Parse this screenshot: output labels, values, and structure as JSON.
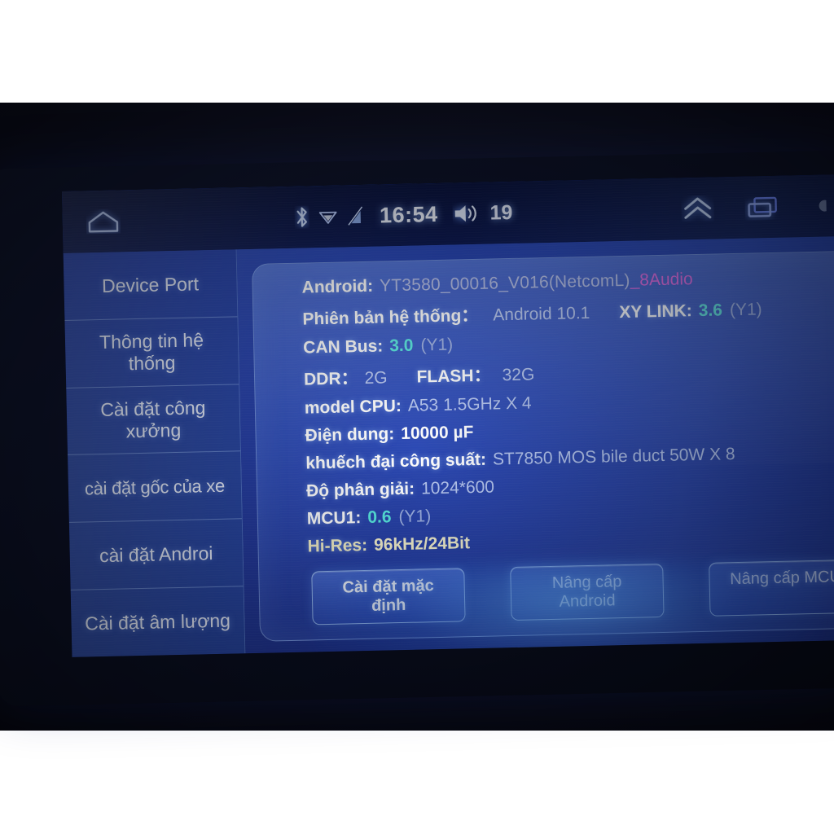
{
  "statusbar": {
    "home_icon": "home-icon",
    "bluetooth_icon": "bluetooth-icon",
    "wifi_icon": "wifi-icon",
    "signal_off_icon": "signal-off-icon",
    "clock": "16:54",
    "volume_icon": "volume-icon",
    "volume_level": "19",
    "chevron_up_icon": "double-chevron-up-icon",
    "recents_icon": "recent-apps-icon"
  },
  "sidebar": {
    "items": [
      {
        "label": "Device Port"
      },
      {
        "label": "Thông tin hệ\nthống"
      },
      {
        "label": "Cài đặt công\nxưởng"
      },
      {
        "label": "cài đặt gốc của xe"
      },
      {
        "label": "cài đặt Androi"
      },
      {
        "label": "Cài đặt âm lượng"
      }
    ]
  },
  "info": {
    "android_label": "Android:",
    "android_value": "YT3580_00016_V016(NetcomL)",
    "android_value_suffix": "_8Audio",
    "system_version_label": "Phiên bản hệ thống：",
    "system_version_value": "Android 10.1",
    "xylink_label": "XY LINK:",
    "xylink_value": "3.6",
    "xylink_paren": "(Y1)",
    "canbus_label": "CAN Bus:",
    "canbus_value": "3.0",
    "canbus_paren": "(Y1)",
    "ddr_label": "DDR：",
    "ddr_value": "2G",
    "flash_label": "FLASH：",
    "flash_value": "32G",
    "cpu_label": "model CPU:",
    "cpu_value": "A53 1.5GHz X 4",
    "capacitance_label": "Điện dung:",
    "capacitance_value": "10000 µF",
    "amplifier_label": "khuếch đại công suất:",
    "amplifier_value": "ST7850 MOS bile duct 50W X 8",
    "resolution_label": "Độ phân giải:",
    "resolution_value": "1024*600",
    "mcu1_label": "MCU1:",
    "mcu1_value": "0.6",
    "mcu1_paren": "(Y1)",
    "hires_label": "Hi-Res:",
    "hires_value": "96kHz/24Bit"
  },
  "buttons": {
    "factory_reset": "Cài đặt mặc định",
    "upgrade_android": "Nâng cấp Android",
    "upgrade_mcu": "Nâng cấp MCU"
  },
  "colors": {
    "screen_blue": "#16309a",
    "sidebar_blue": "#2340ab",
    "accent_cyan": "#57e8e0",
    "accent_magenta": "#e45ee0",
    "text_dim": "#b9c9f2"
  }
}
